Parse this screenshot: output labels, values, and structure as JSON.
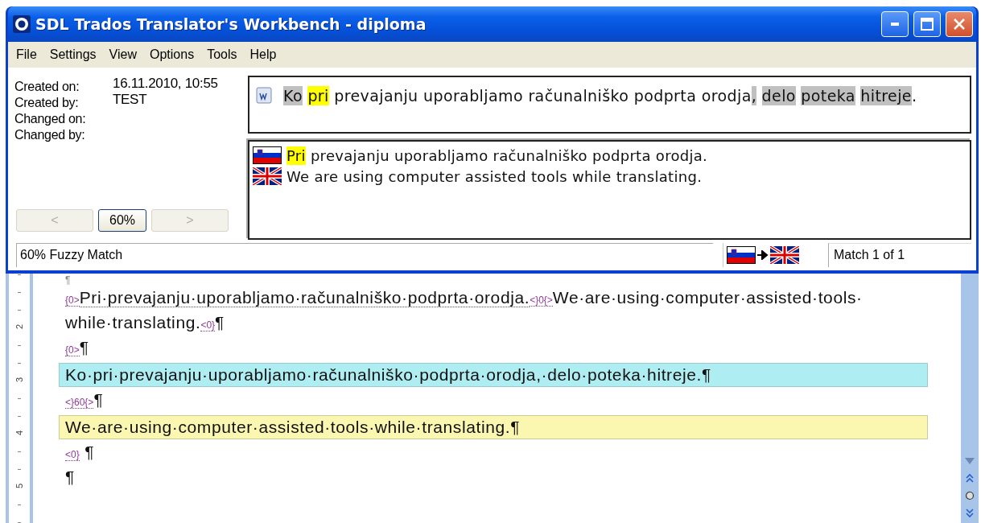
{
  "window": {
    "title": "SDL Trados Translator's Workbench - diploma"
  },
  "menu": [
    "File",
    "Settings",
    "View",
    "Options",
    "Tools",
    "Help"
  ],
  "info": [
    {
      "label": "Created on:",
      "value": "16.11.2010, 10:55"
    },
    {
      "label": "Created by:",
      "value": "TEST"
    },
    {
      "label": "Changed on:"
    },
    {
      "label": "Changed by:"
    }
  ],
  "nav": [
    {
      "label": "<",
      "disabled": true
    },
    {
      "label": "60%",
      "disabled": false
    },
    {
      "label": ">",
      "disabled": true
    }
  ],
  "source_segment": {
    "parts": [
      {
        "text": "Ko",
        "color": "#c0c0c0"
      },
      {
        "text": "pri",
        "color": "#ffff00"
      },
      {
        "text": "prevajanju uporabljamo računalniško podprta orodja"
      },
      {
        "text": ",",
        "color": "#c0c0c0",
        "attached": true
      },
      {
        "text": "delo",
        "color": "#c0c0c0"
      },
      {
        "text": "poteka",
        "color": "#c0c0c0"
      },
      {
        "text": "hitreje",
        "color": "#c0c0c0"
      },
      {
        "text": ".",
        "attached": true
      }
    ]
  },
  "match_rows": [
    {
      "flag": {
        "kind": "si"
      },
      "parts": [
        {
          "text": "Pri",
          "color": "#ffff00"
        },
        {
          "text": "prevajanju uporabljamo računalniško podprta orodja."
        }
      ]
    },
    {
      "flag": {
        "kind": "gb"
      },
      "parts": [
        {
          "text": "We are using computer assisted tools while translating."
        }
      ]
    }
  ],
  "status": {
    "match_type": "60% Fuzzy Match",
    "from_flag": {
      "kind": "si"
    },
    "to_flag": {
      "kind": "gb"
    },
    "match_count": "Match 1 of 1"
  },
  "document": {
    "ruler": [
      "2",
      "3",
      "4",
      "5"
    ],
    "paragraphs": [
      {
        "kind": "faint",
        "parts": [
          {
            "kind": "text",
            "text": "¶"
          }
        ]
      },
      {
        "kind": "plain",
        "parts": [
          {
            "kind": "tag",
            "text": "{0>"
          },
          {
            "kind": "source",
            "text": "Pri·prevajanju·uporabljamo·računalniško·podprta·orodja."
          },
          {
            "kind": "tag",
            "text": "<}0{>"
          },
          {
            "kind": "text",
            "text": "We·are·using·computer·assisted·tools· while·translating."
          },
          {
            "kind": "tag",
            "text": "<0}"
          },
          {
            "kind": "text",
            "text": "¶"
          }
        ]
      },
      {
        "kind": "plain",
        "parts": [
          {
            "kind": "tag",
            "text": "{0>"
          },
          {
            "kind": "text",
            "text": "¶"
          }
        ]
      },
      {
        "kind": "source_segment",
        "parts": [
          {
            "kind": "text",
            "text": "Ko·pri·prevajanju·uporabljamo·računalniško·podprta·orodja,·delo·poteka·hitreje.¶"
          }
        ]
      },
      {
        "kind": "plain",
        "parts": [
          {
            "kind": "tag",
            "text": "<}60{>"
          },
          {
            "kind": "text",
            "text": "¶"
          }
        ]
      },
      {
        "kind": "target_segment",
        "parts": [
          {
            "kind": "text",
            "text": "We·are·using·computer·assisted·tools·while·translating.¶"
          }
        ]
      },
      {
        "kind": "plain",
        "parts": [
          {
            "kind": "tag",
            "text": "<0}"
          },
          {
            "kind": "text",
            "text": " ¶"
          }
        ]
      },
      {
        "kind": "plain",
        "parts": [
          {
            "kind": "text",
            "text": "¶"
          }
        ]
      }
    ]
  }
}
